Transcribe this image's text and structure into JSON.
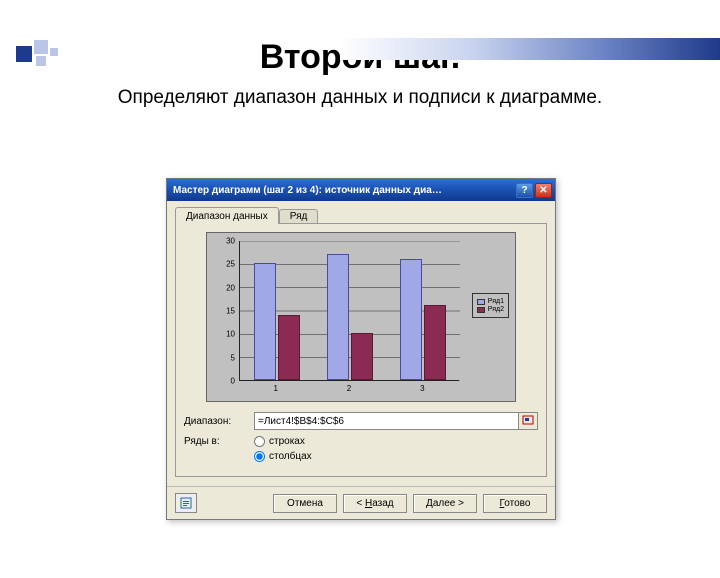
{
  "slide": {
    "title": "Второй шаг.",
    "subtitle": "Определяют диапазон данных и подписи к диаграмме."
  },
  "dialog": {
    "title": "Мастер диаграмм (шаг 2 из 4): источник данных диа…",
    "help_label": "?",
    "close_label": "✕",
    "tabs": {
      "range": "Диапазон данных",
      "series": "Ряд"
    },
    "range_label": "Диапазон:",
    "range_value": "=Лист4!$B$4:$C$6",
    "rows_label": "Ряды в:",
    "radio_rows": "строках",
    "radio_cols": "столбцах",
    "radio_selected": "cols",
    "buttons": {
      "cancel": "Отмена",
      "back": "< Назад",
      "next": "Далее >",
      "finish": "Готово"
    }
  },
  "chart_data": {
    "type": "bar",
    "categories": [
      "1",
      "2",
      "3"
    ],
    "series": [
      {
        "name": "Ряд1",
        "values": [
          25,
          27,
          26
        ],
        "color": "#a0a8e8"
      },
      {
        "name": "Ряд2",
        "values": [
          14,
          10,
          16
        ],
        "color": "#8b2a52"
      }
    ],
    "yticks": [
      "0",
      "5",
      "10",
      "15",
      "20",
      "25",
      "30"
    ],
    "ylim": [
      0,
      30
    ],
    "title": "",
    "xlabel": "",
    "ylabel": ""
  }
}
